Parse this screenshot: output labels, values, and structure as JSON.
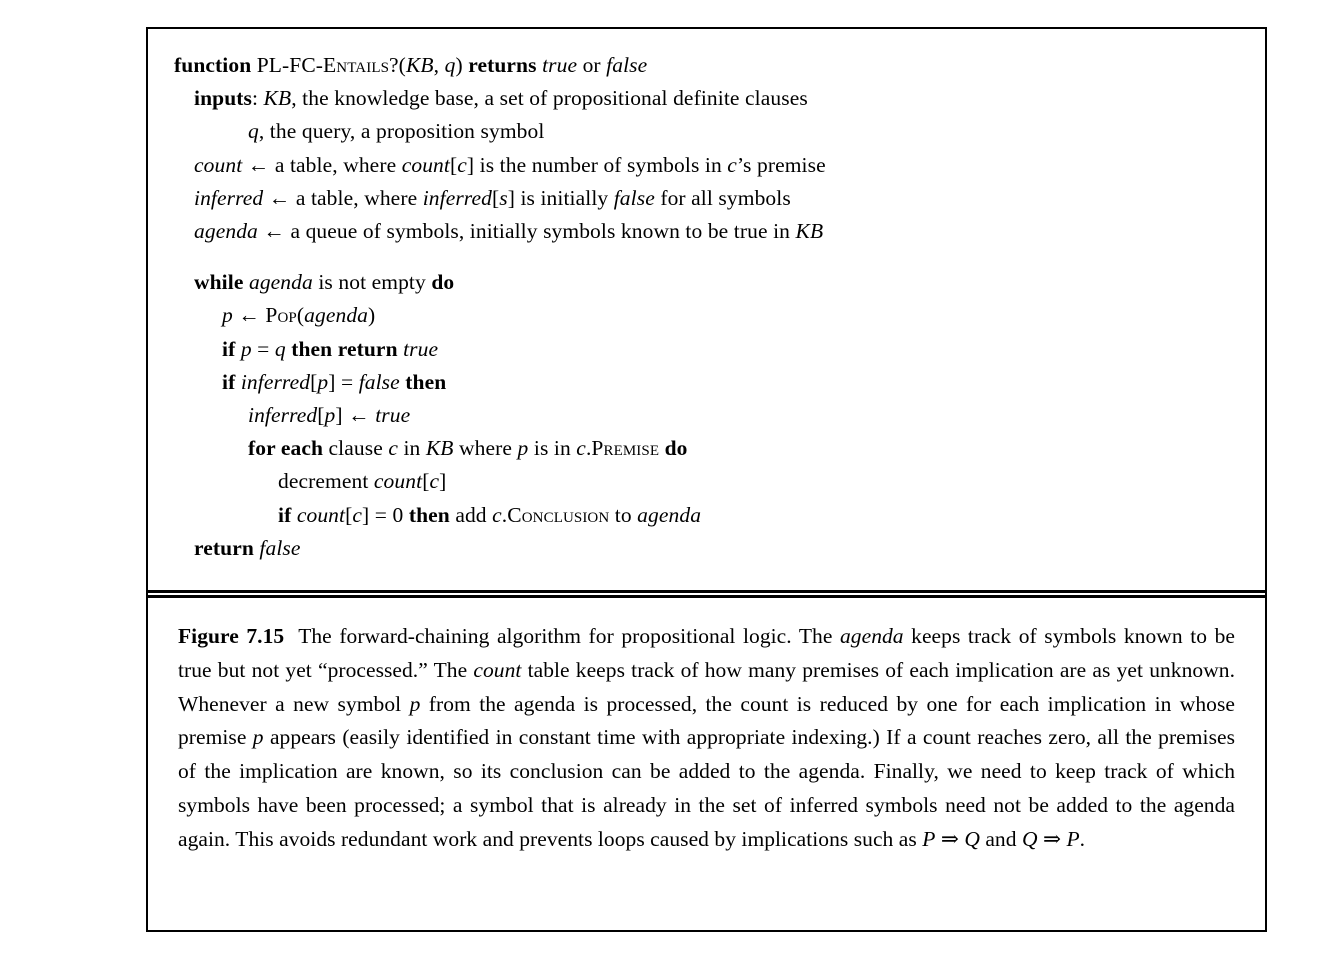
{
  "figure": {
    "id": "Figure 7.15",
    "algorithm_name": "PL-FC-Entails?",
    "code": {
      "l1_kw": "function",
      "l1_name_a": "PL-FC-E",
      "l1_name_b": "ntails",
      "l1_name_q": "?(",
      "l1_kb": "KB",
      "l1_comma": ", ",
      "l1_q": "q",
      "l1_paren": ") ",
      "l1_returns": "returns",
      "l1_true": "true",
      "l1_or": " or ",
      "l1_false": "false",
      "l2_kw": "inputs",
      "l2_colon": ": ",
      "l2_kb": "KB",
      "l2_rest": ", the knowledge base, a set of propositional definite clauses",
      "l3_q": "q",
      "l3_rest": ", the query, a proposition symbol",
      "l4_count": "count",
      "l4_arrow": " ← ",
      "l4_a": "a table, where ",
      "l4_count2": "count",
      "l4_b": "[",
      "l4_c": "c",
      "l4_d": "] is the number of symbols in ",
      "l4_c2": "c",
      "l4_e": "’s premise",
      "l5_inferred": "inferred",
      "l5_arrow": " ← ",
      "l5_a": "a table, where ",
      "l5_inferred2": "inferred",
      "l5_b": "[",
      "l5_s": "s",
      "l5_c": "] is initially ",
      "l5_false": "false",
      "l5_d": " for all symbols",
      "l6_agenda": "agenda",
      "l6_arrow": " ← ",
      "l6_a": "a queue of symbols, initially symbols known to be true in ",
      "l6_kb": "KB",
      "l7_while": "while",
      "l7_agenda": "agenda",
      "l7_mid": " is not empty ",
      "l7_do": "do",
      "l8_p": "p",
      "l8_arrow": " ← ",
      "l8_pop": "Pop",
      "l8_open": "(",
      "l8_agenda": "agenda",
      "l8_close": ")",
      "l9_if": "if",
      "l9_p": "p",
      "l9_eq": " = ",
      "l9_q": "q",
      "l9_thenreturn": "then return",
      "l9_true": "true",
      "l10_if": "if",
      "l10_inferred": "inferred",
      "l10_open": "[",
      "l10_p": "p",
      "l10_close": "]",
      "l10_eq": " = ",
      "l10_false": "false",
      "l10_then": "then",
      "l11_inferred": "inferred",
      "l11_open": "[",
      "l11_p": "p",
      "l11_close": "]",
      "l11_arrow": " ← ",
      "l11_true": "true",
      "l12_foreach": "for each",
      "l12_clause": " clause ",
      "l12_c": "c",
      "l12_in": " in ",
      "l12_kb": "KB",
      "l12_where": " where ",
      "l12_p": "p",
      "l12_isin": " is in ",
      "l12_cdot": "c",
      "l12_dot": ".",
      "l12_premise": "Premise",
      "l12_do": "do",
      "l13_decrement": "decrement ",
      "l13_count": "count",
      "l13_open": "[",
      "l13_c": "c",
      "l13_close": "]",
      "l14_if": "if",
      "l14_count": "count",
      "l14_open": "[",
      "l14_c": "c",
      "l14_close": "]",
      "l14_eq": " = 0 ",
      "l14_then": "then",
      "l14_add": " add ",
      "l14_cdot": "c",
      "l14_dot": ".",
      "l14_conclusion": "Conclusion",
      "l14_to": " to ",
      "l14_agenda": "agenda",
      "l15_return": "return",
      "l15_false": "false"
    },
    "caption": {
      "label": "Figure 7.15",
      "p1": "The forward-chaining algorithm for propositional logic. The ",
      "agenda1": "agenda",
      "p2": " keeps track of symbols known to be true but not yet “processed.” The ",
      "count1": "count",
      "p3": " table keeps track of how many premises of each implication are as yet unknown. Whenever a new symbol ",
      "p_var1": "p",
      "p4": " from the agenda is processed, the count is reduced by one for each implication in whose premise ",
      "p_var2": "p",
      "p5": " appears (easily identified in constant time with appropriate indexing.) If a count reaches zero, all the premises of the implication are known, so its conclusion can be added to the agenda. Finally, we need to keep track of which symbols have been processed; a symbol that is already in the set of inferred symbols need not be added to the agenda again. This avoids redundant work and prevents loops caused by implications such as ",
      "P1": "P",
      "arrow1": " ⇒ ",
      "Q1": "Q",
      "and": " and ",
      "Q2": "Q",
      "arrow2": " ⇒ ",
      "P2": "P",
      "period": "."
    }
  },
  "colors": {
    "ink": "#000000",
    "paper": "#ffffff"
  }
}
